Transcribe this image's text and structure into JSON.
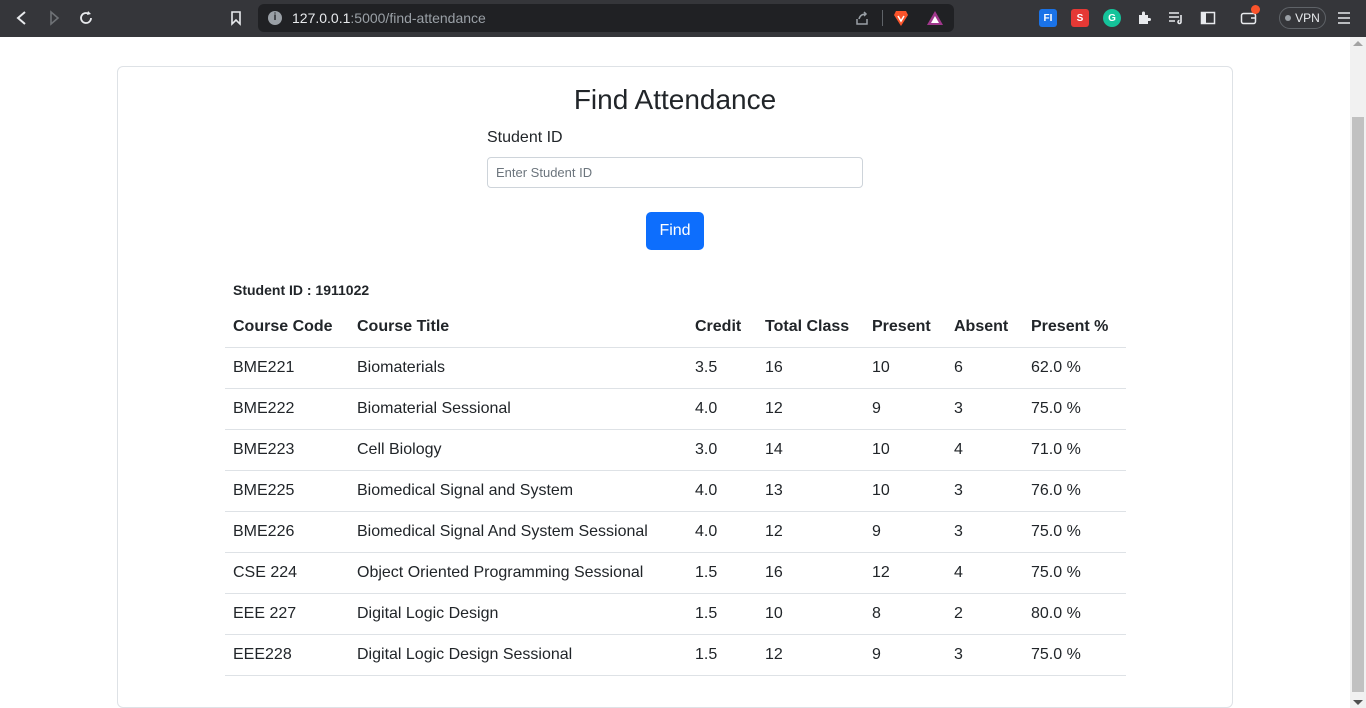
{
  "browser": {
    "url_host": "127.0.0.1",
    "url_path": ":5000/find-attendance",
    "vpn_label": "VPN",
    "extensions": [
      "fi-extension-icon",
      "pdf-extension-icon",
      "grammarly-icon",
      "puzzle-icon"
    ]
  },
  "page": {
    "title": "Find Attendance",
    "field_label": "Student ID",
    "input_placeholder": "Enter Student ID",
    "input_value": "",
    "find_label": "Find",
    "student_line": "Student ID : 1911022"
  },
  "table": {
    "headers": [
      "Course Code",
      "Course Title",
      "Credit",
      "Total Class",
      "Present",
      "Absent",
      "Present %"
    ],
    "rows": [
      [
        "BME221",
        "Biomaterials",
        "3.5",
        "16",
        "10",
        "6",
        "62.0 %"
      ],
      [
        "BME222",
        "Biomaterial Sessional",
        "4.0",
        "12",
        "9",
        "3",
        "75.0 %"
      ],
      [
        "BME223",
        "Cell Biology",
        "3.0",
        "14",
        "10",
        "4",
        "71.0 %"
      ],
      [
        "BME225",
        "Biomedical Signal and System",
        "4.0",
        "13",
        "10",
        "3",
        "76.0 %"
      ],
      [
        "BME226",
        "Biomedical Signal And System Sessional",
        "4.0",
        "12",
        "9",
        "3",
        "75.0 %"
      ],
      [
        "CSE 224",
        "Object Oriented Programming Sessional",
        "1.5",
        "16",
        "12",
        "4",
        "75.0 %"
      ],
      [
        "EEE 227",
        "Digital Logic Design",
        "1.5",
        "10",
        "8",
        "2",
        "80.0 %"
      ],
      [
        "EEE228",
        "Digital Logic Design Sessional",
        "1.5",
        "12",
        "9",
        "3",
        "75.0 %"
      ]
    ]
  },
  "colors": {
    "primary": "#0d6efd",
    "chrome": "#35363a"
  }
}
